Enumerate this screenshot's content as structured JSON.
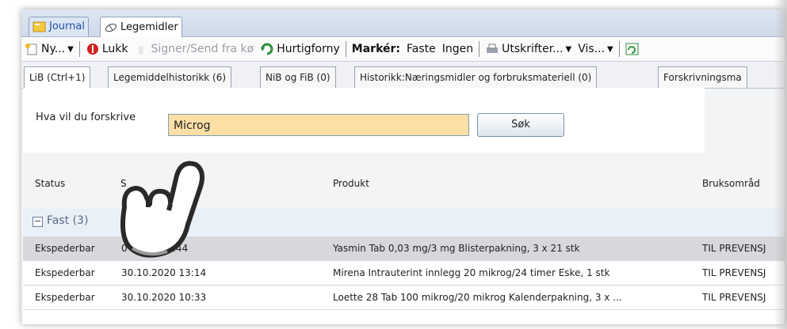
{
  "top_tabs": [
    {
      "label": "Journal",
      "icon": "journal-icon"
    },
    {
      "label": "Legemidler",
      "icon": "pills-icon"
    }
  ],
  "toolbar": {
    "new_label": "Ny...",
    "close_label": "Lukk",
    "sign_label": "Signer/Send fra kø",
    "quick_renew_label": "Hurtigforny",
    "mark_label": "Markér:",
    "fixed_label": "Faste",
    "none_label": "Ingen",
    "print_label": "Utskrifter...",
    "view_label": "Vis..."
  },
  "subtabs": [
    "LiB (Ctrl+1)",
    "Legemiddelhistorikk (6)",
    "NiB og FiB (0)",
    "Historikk:Næringsmidler og forbruksmateriell (0)",
    "Forskrivningsma"
  ],
  "search": {
    "label": "Hva vil du forskrive",
    "value": "Microg",
    "button_label": "Søk"
  },
  "grid": {
    "columns": [
      "Status",
      "S",
      "Produkt",
      "Bruksområd"
    ],
    "group_label": "Fast (3)",
    "rows": [
      {
        "status": "Ekspederbar",
        "date": "0 .2021 14:44",
        "product": "Yasmin Tab 0,03 mg/3 mg Blisterpakning, 3 x 21 stk",
        "use": "TIL PREVENSJ",
        "selected": true
      },
      {
        "status": "Ekspederbar",
        "date": "30.10.2020 13:14",
        "product": "Mirena Intrauterint innlegg 20 mikrog/24 timer Eske, 1 stk",
        "use": "TIL PREVENSJ",
        "selected": false
      },
      {
        "status": "Ekspederbar",
        "date": "30.10.2020 10:33",
        "product": "Loette 28 Tab 100 mikrog/20 mikrog Kalenderpakning, 3 x ...",
        "use": "TIL PREVENSJ",
        "selected": false
      }
    ]
  },
  "colors": {
    "search_highlight": "#fcdfa5",
    "selected_row": "#d7d8dc",
    "close_icon_red": "#d42020"
  }
}
